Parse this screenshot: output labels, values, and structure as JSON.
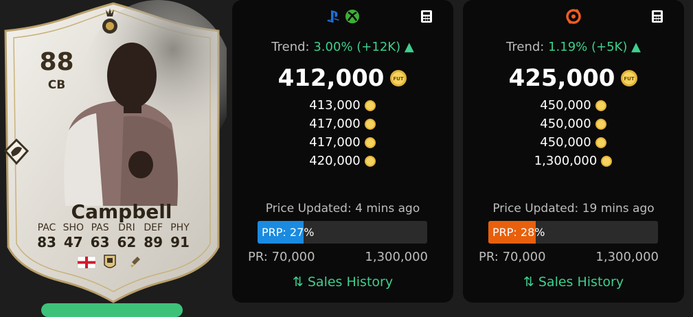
{
  "player": {
    "rating": "88",
    "position": "CB",
    "name": "Campbell",
    "stats": [
      {
        "label": "PAC",
        "value": "83"
      },
      {
        "label": "SHO",
        "value": "47"
      },
      {
        "label": "PAS",
        "value": "63"
      },
      {
        "label": "DRI",
        "value": "62"
      },
      {
        "label": "DEF",
        "value": "89"
      },
      {
        "label": "PHY",
        "value": "91"
      }
    ]
  },
  "coin_label": "FUT",
  "panels": [
    {
      "platform": "console",
      "icons": [
        "playstation-icon",
        "xbox-icon"
      ],
      "trend_label": "Trend:",
      "trend_value": "3.00% (+12K)",
      "price": "412,000",
      "listings": [
        "413,000",
        "417,000",
        "417,000",
        "420,000"
      ],
      "updated": "Price Updated: 4 mins ago",
      "prp_label": "PRP: 27%",
      "prp_fraction": 0.27,
      "prp_color": "#1a8be0",
      "pr_min": "PR: 70,000",
      "pr_max": "1,300,000",
      "sales_label": "Sales History"
    },
    {
      "platform": "pc",
      "icons": [
        "origin-icon"
      ],
      "trend_label": "Trend:",
      "trend_value": "1.19% (+5K)",
      "price": "425,000",
      "listings": [
        "450,000",
        "450,000",
        "450,000",
        "1,300,000"
      ],
      "updated": "Price Updated: 19 mins ago",
      "prp_label": "PRP: 28%",
      "prp_fraction": 0.28,
      "prp_color": "#e8600c",
      "pr_min": "PR: 70,000",
      "pr_max": "1,300,000",
      "sales_label": "Sales History"
    }
  ],
  "colors": {
    "accent_green": "#3ecf8e",
    "coin_gold": "#e2b23a"
  }
}
